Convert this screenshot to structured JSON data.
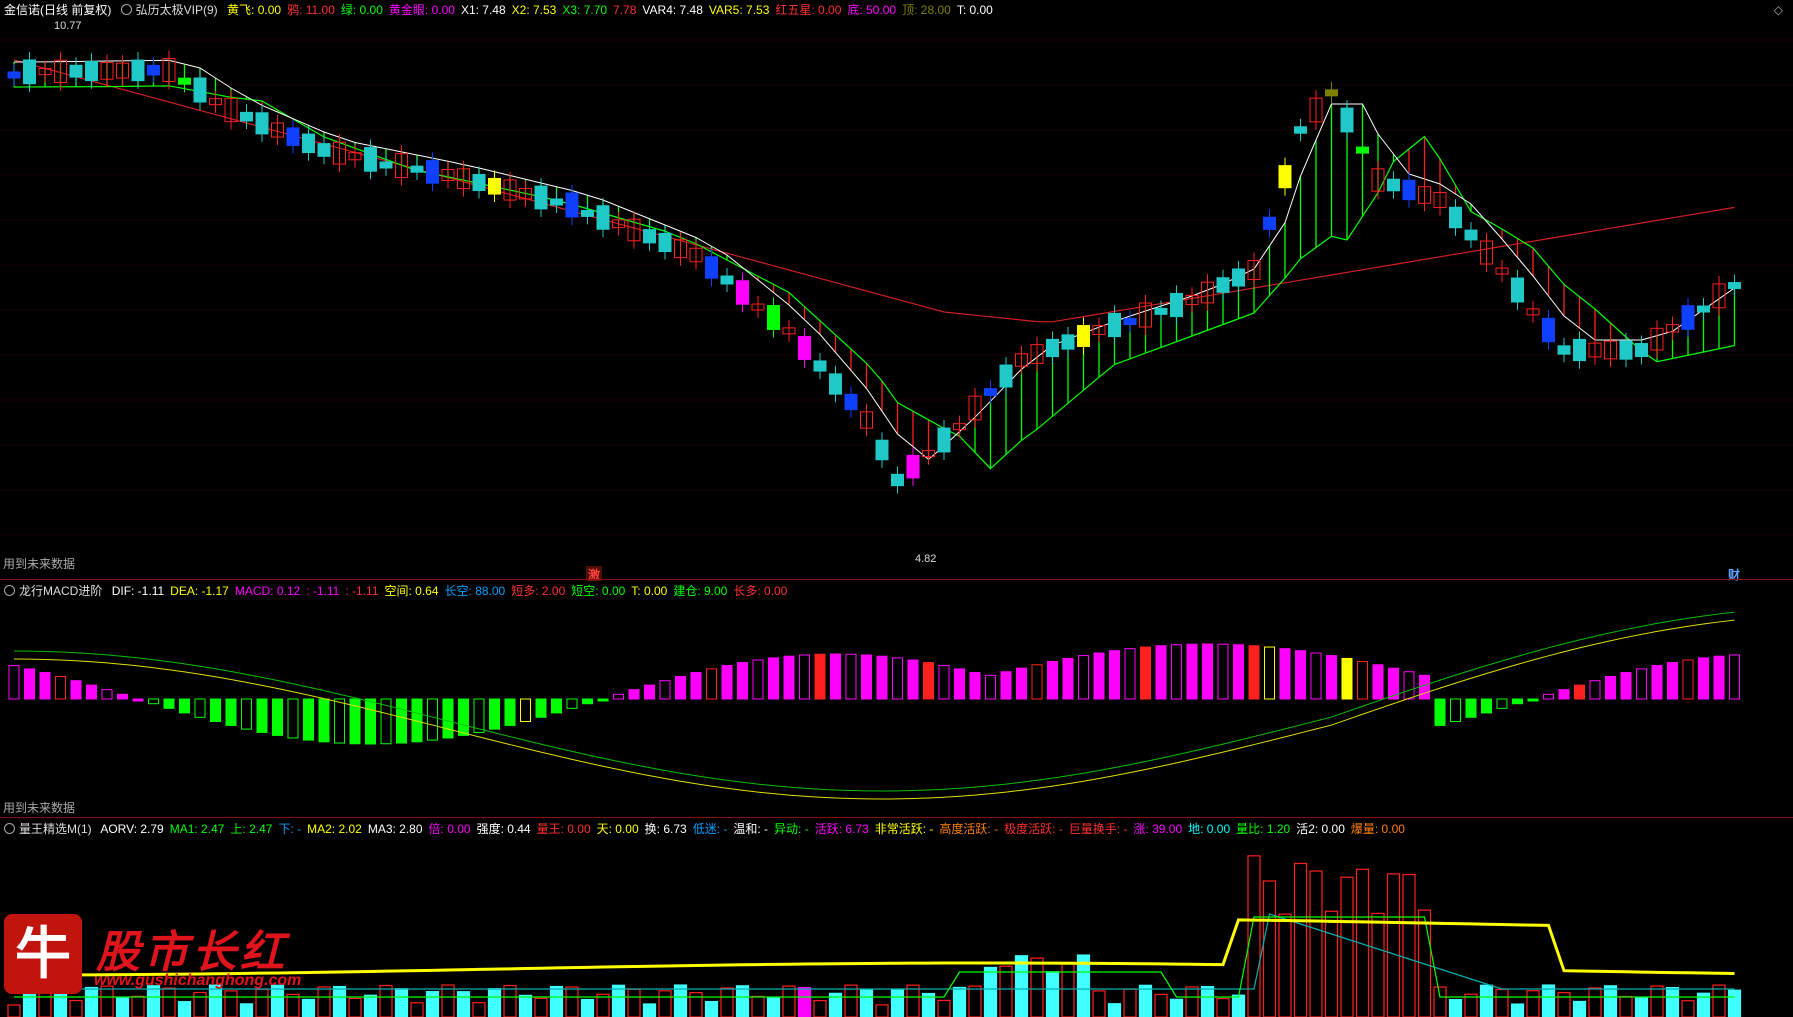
{
  "main_header": {
    "stock": "金信诺(日线 前复权)",
    "indicator": "弘历太极VIP(9)",
    "fields": [
      {
        "k": "黄飞:",
        "v": "0.00",
        "c": "#ffff00"
      },
      {
        "k": "鸦:",
        "v": "11.00",
        "c": "#ff3030"
      },
      {
        "k": "绿:",
        "v": "0.00",
        "c": "#00ff00"
      },
      {
        "k": "黄金眼:",
        "v": "0.00",
        "c": "#ff00ff"
      },
      {
        "k": "X1:",
        "v": "7.48",
        "c": "#ffffff"
      },
      {
        "k": "X2:",
        "v": "7.53",
        "c": "#ffff00"
      },
      {
        "k": "X3:",
        "v": "7.70",
        "c": "#00ff00"
      },
      {
        "k": "",
        "v": "7.78",
        "c": "#ff3030"
      },
      {
        "k": "VAR4:",
        "v": "7.48",
        "c": "#ffffff"
      },
      {
        "k": "VAR5:",
        "v": "7.53",
        "c": "#ffff00"
      },
      {
        "k": "红五星:",
        "v": "0.00",
        "c": "#ff3030"
      },
      {
        "k": "底:",
        "v": "50.00",
        "c": "#ff00ff"
      },
      {
        "k": "顶:",
        "v": "28.00",
        "c": "#808000"
      },
      {
        "k": "T:",
        "v": "0.00",
        "c": "#ffffff"
      }
    ],
    "high_label": "10.77",
    "low_label": "4.82",
    "note": "用到未来数据",
    "tag_a": "激",
    "tag_b": "财",
    "corner_icon": "◇",
    "corner_icon_name": "diamond-icon"
  },
  "macd_header": {
    "indicator": "龙行MACD进阶",
    "fields": [
      {
        "k": "DIF:",
        "v": "-1.11",
        "c": "#ffffff"
      },
      {
        "k": "DEA:",
        "v": "-1.17",
        "c": "#ffff00"
      },
      {
        "k": "MACD:",
        "v": "0.12",
        "c": "#ff00ff"
      },
      {
        "k": ":",
        "v": "-1.11",
        "c": "#ff00ff"
      },
      {
        "k": ":",
        "v": "-1.11",
        "c": "#ff3030"
      },
      {
        "k": "空间:",
        "v": "0.64",
        "c": "#ffff00"
      },
      {
        "k": "长空:",
        "v": "88.00",
        "c": "#00a0ff"
      },
      {
        "k": "短多:",
        "v": "2.00",
        "c": "#ff3030"
      },
      {
        "k": "短空:",
        "v": "0.00",
        "c": "#00ff00"
      },
      {
        "k": "T:",
        "v": "0.00",
        "c": "#ffff00"
      },
      {
        "k": "建仓:",
        "v": "9.00",
        "c": "#00ff00"
      },
      {
        "k": "长多:",
        "v": "0.00",
        "c": "#ff3030"
      }
    ],
    "note": "用到未来数据"
  },
  "vol_header": {
    "indicator": "量王精选M(1)",
    "fields": [
      {
        "k": "AORV:",
        "v": "2.79",
        "c": "#ffffff"
      },
      {
        "k": "MA1:",
        "v": "2.47",
        "c": "#00ff00"
      },
      {
        "k": "上:",
        "v": "2.47",
        "c": "#00ff00"
      },
      {
        "k": "下:",
        "v": "-",
        "c": "#00a0ff"
      },
      {
        "k": "MA2:",
        "v": "2.02",
        "c": "#ffff00"
      },
      {
        "k": "MA3:",
        "v": "2.80",
        "c": "#ffffff"
      },
      {
        "k": "倍:",
        "v": "0.00",
        "c": "#ff00ff"
      },
      {
        "k": "强度:",
        "v": "0.44",
        "c": "#ffffff"
      },
      {
        "k": "量王:",
        "v": "0.00",
        "c": "#ff3030"
      },
      {
        "k": "天:",
        "v": "0.00",
        "c": "#ffff00"
      },
      {
        "k": "换:",
        "v": "6.73",
        "c": "#ffffff"
      },
      {
        "k": "低迷:",
        "v": "-",
        "c": "#00a0ff"
      },
      {
        "k": "温和:",
        "v": "-",
        "c": "#ffffff"
      },
      {
        "k": "异动:",
        "v": "-",
        "c": "#00ff00"
      },
      {
        "k": "活跃:",
        "v": "6.73",
        "c": "#ff00ff"
      },
      {
        "k": "非常活跃:",
        "v": "-",
        "c": "#ffff00"
      },
      {
        "k": "高度活跃:",
        "v": "-",
        "c": "#ff8000"
      },
      {
        "k": "极度活跃:",
        "v": "-",
        "c": "#ff3030"
      },
      {
        "k": "巨量换手:",
        "v": "-",
        "c": "#ff3030"
      },
      {
        "k": "涨:",
        "v": "39.00",
        "c": "#ff00ff"
      },
      {
        "k": "地:",
        "v": "0.00",
        "c": "#00ffff"
      },
      {
        "k": "量比:",
        "v": "1.20",
        "c": "#00ff00"
      },
      {
        "k": "活2:",
        "v": "0.00",
        "c": "#ffffff"
      },
      {
        "k": "爆量:",
        "v": "0.00",
        "c": "#ff8000"
      }
    ]
  },
  "watermark": {
    "glyph": "牛",
    "name": "股市长红",
    "url": "www.gushichanghong.com"
  },
  "colors": {
    "up": "#ff2020",
    "down": "#20c8c8",
    "blue": "#1040ff",
    "yellow": "#ffff00",
    "magenta": "#ff00ff",
    "green": "#00ff00",
    "olive": "#808000",
    "grid": "#8a1010"
  }
}
